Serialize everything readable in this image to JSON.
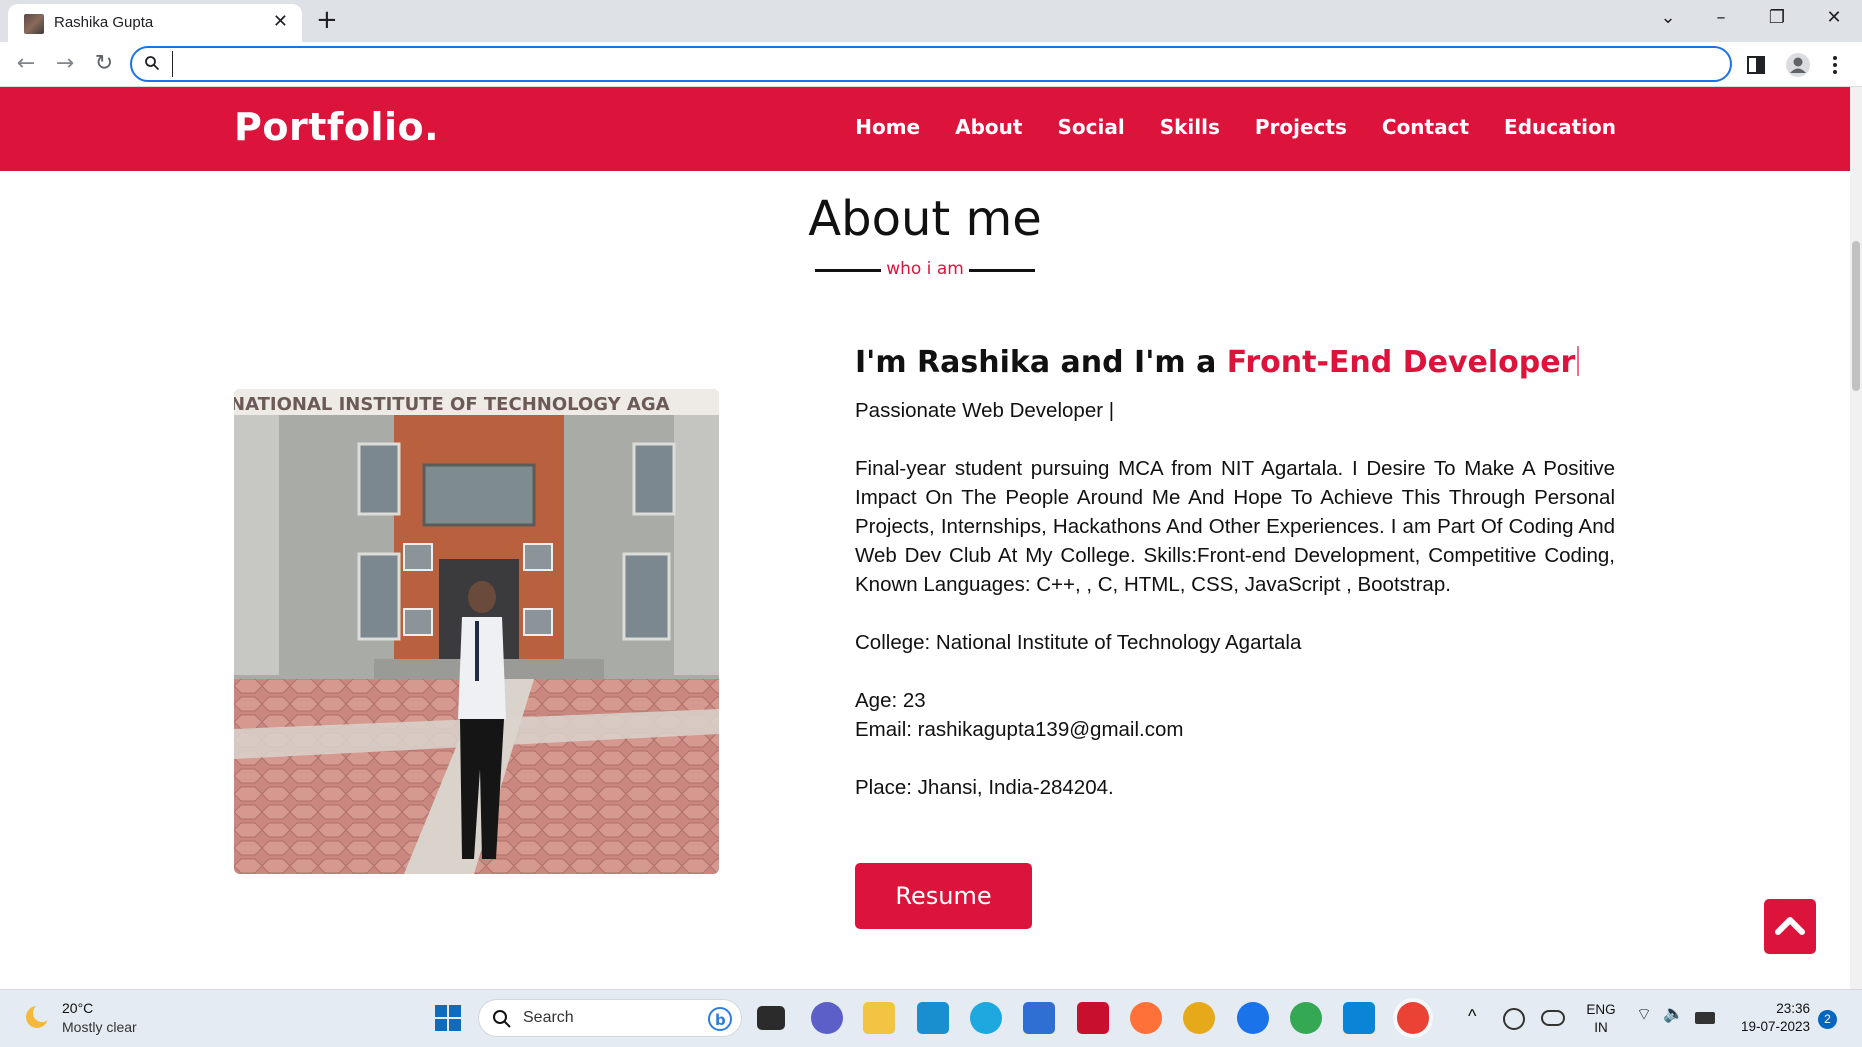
{
  "browser": {
    "tab_title": "Rashika Gupta",
    "address_value": "",
    "address_placeholder": ""
  },
  "navbar": {
    "logo": "Portfolio.",
    "links": [
      "Home",
      "About",
      "Social",
      "Skills",
      "Projects",
      "Contact",
      "Education"
    ]
  },
  "about": {
    "heading": "About me",
    "subheading": "who i am",
    "intro_prefix": "I'm Rashika and I'm a ",
    "intro_role": "Front-End Developer",
    "tagline": "Passionate Web Developer |",
    "bio": "Final-year student pursuing MCA from NIT Agartala. I Desire To Make A Positive Impact On The People Around Me And Hope To Achieve This Through Personal Projects, Internships, Hackathons And Other Experiences. I am Part Of Coding And Web Dev Club At My College. Skills:Front-end Development, Competitive Coding, Known Languages: C++, , C, HTML, CSS, JavaScript , Bootstrap.",
    "college": "College: National Institute of Technology Agartala",
    "age": "Age: 23",
    "email": "Email: rashikagupta139@gmail.com",
    "place": "Place: Jhansi, India-284204.",
    "resume_label": "Resume",
    "photo_banner": "NATIONAL INSTITUTE OF TECHNOLOGY AGA"
  },
  "taskbar": {
    "weather_temp": "20°C",
    "weather_desc": "Mostly clear",
    "search_label": "Search",
    "lang_line1": "ENG",
    "lang_line2": "IN",
    "time": "23:36",
    "date": "19-07-2023",
    "notification_count": "2",
    "apps": [
      "windows-start",
      "file-explorer",
      "zoom",
      "folder",
      "mybp",
      "edge",
      "store",
      "mcafee",
      "firefox",
      "chrome-canary",
      "help",
      "chrome",
      "vscode",
      "chrome-active"
    ]
  },
  "colors": {
    "accent": "#dc143c",
    "omnibox_focus": "#1a73e8"
  }
}
